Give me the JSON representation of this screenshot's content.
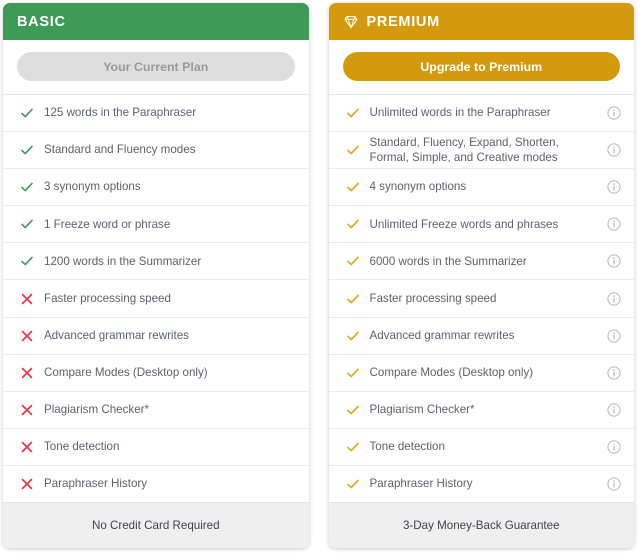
{
  "plans": [
    {
      "id": "basic",
      "name": "BASIC",
      "header_color": "#3f9a57",
      "has_gem_icon": false,
      "cta": {
        "label": "Your Current Plan",
        "style": "disabled",
        "bg_color": "#dedede",
        "text_color": "#9a9a9a"
      },
      "features": [
        {
          "label": "125 words in the Paraphraser",
          "mark": "check",
          "mark_color": "#3f9a57",
          "info": false
        },
        {
          "label": "Standard and Fluency modes",
          "mark": "check",
          "mark_color": "#3f9a57",
          "info": false
        },
        {
          "label": "3 synonym options",
          "mark": "check",
          "mark_color": "#3f9a57",
          "info": false
        },
        {
          "label": "1 Freeze word or phrase",
          "mark": "check",
          "mark_color": "#3f9a57",
          "info": false
        },
        {
          "label": "1200 words in the Summarizer",
          "mark": "check",
          "mark_color": "#3f9a57",
          "info": false
        },
        {
          "label": "Faster processing speed",
          "mark": "cross",
          "mark_color": "#e8394a",
          "info": false
        },
        {
          "label": "Advanced grammar rewrites",
          "mark": "cross",
          "mark_color": "#e8394a",
          "info": false
        },
        {
          "label": "Compare Modes (Desktop only)",
          "mark": "cross",
          "mark_color": "#e8394a",
          "info": false
        },
        {
          "label": "Plagiarism Checker*",
          "mark": "cross",
          "mark_color": "#e8394a",
          "info": false
        },
        {
          "label": "Tone detection",
          "mark": "cross",
          "mark_color": "#e8394a",
          "info": false
        },
        {
          "label": "Paraphraser History",
          "mark": "cross",
          "mark_color": "#e8394a",
          "info": false
        }
      ],
      "footer": "No Credit Card Required"
    },
    {
      "id": "premium",
      "name": "PREMIUM",
      "header_color": "#d49a0d",
      "has_gem_icon": true,
      "cta": {
        "label": "Upgrade to Premium",
        "style": "upgrade",
        "bg_color": "#d49a0d",
        "text_color": "#ffffff"
      },
      "features": [
        {
          "label": "Unlimited words in the Paraphraser",
          "mark": "check",
          "mark_color": "#e2a31a",
          "info": true
        },
        {
          "label": "Standard, Fluency, Expand, Shorten, Formal, Simple, and Creative modes",
          "mark": "check",
          "mark_color": "#e2a31a",
          "info": true
        },
        {
          "label": "4 synonym options",
          "mark": "check",
          "mark_color": "#e2a31a",
          "info": true
        },
        {
          "label": "Unlimited Freeze words and phrases",
          "mark": "check",
          "mark_color": "#e2a31a",
          "info": true
        },
        {
          "label": "6000 words in the Summarizer",
          "mark": "check",
          "mark_color": "#e2a31a",
          "info": true
        },
        {
          "label": "Faster processing speed",
          "mark": "check",
          "mark_color": "#e2a31a",
          "info": true
        },
        {
          "label": "Advanced grammar rewrites",
          "mark": "check",
          "mark_color": "#e2a31a",
          "info": true
        },
        {
          "label": "Compare Modes (Desktop only)",
          "mark": "check",
          "mark_color": "#e2a31a",
          "info": true
        },
        {
          "label": "Plagiarism Checker*",
          "mark": "check",
          "mark_color": "#e2a31a",
          "info": true
        },
        {
          "label": "Tone detection",
          "mark": "check",
          "mark_color": "#e2a31a",
          "info": true
        },
        {
          "label": "Paraphraser History",
          "mark": "check",
          "mark_color": "#e2a31a",
          "info": true
        }
      ],
      "footer": "3-Day Money-Back Guarantee"
    }
  ],
  "icons": {
    "gem": "gem-icon",
    "check": "check-icon",
    "cross": "cross-icon",
    "info": "info-icon"
  }
}
